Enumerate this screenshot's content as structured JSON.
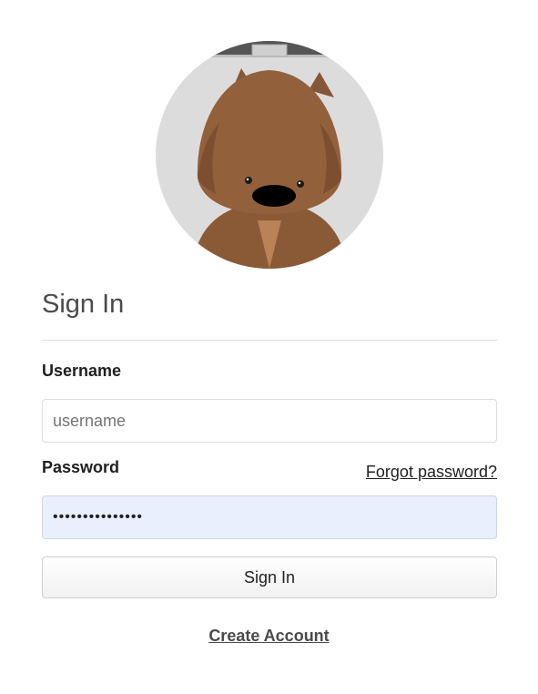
{
  "avatar": {
    "icon": "wombat-mascot-icon",
    "colors": {
      "background": "#dcdcdc",
      "fur": "#93603c",
      "fur_dark": "#7d4f30",
      "chest": "#b98257",
      "nose": "#000000",
      "frame": "#555555"
    }
  },
  "form": {
    "title": "Sign In",
    "username_label": "Username",
    "username_placeholder": "username",
    "username_value": "",
    "password_label": "Password",
    "password_value": "•••••••••••••••",
    "forgot_link": "Forgot password?",
    "submit_label": "Sign In",
    "create_account_link": "Create Account"
  }
}
